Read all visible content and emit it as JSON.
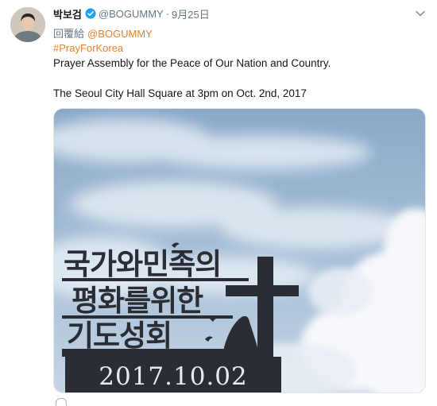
{
  "tweet": {
    "display_name": "박보검",
    "handle": "@BOGUMMY",
    "separator": "·",
    "date": "9月25日",
    "reply_prefix": "回覆給",
    "reply_handle": "@BOGUMMY",
    "hashtag": "#PrayForKorea",
    "body_line1": "Prayer Assembly for the Peace of Our Nation and Country.",
    "body_line2": "The Seoul City Hall Square at 3pm on Oct. 2nd, 2017"
  },
  "media": {
    "sign_line1": "국가와민족의",
    "sign_line2": "평화를위한",
    "sign_line3": "기도성회",
    "sign_date": "2017.10.02"
  },
  "icons": {
    "avatar": "avatar",
    "verified": "verified-badge-icon",
    "caret": "chevron-down-icon",
    "reply_action": "reply-icon"
  },
  "colors": {
    "link": "#e8822b",
    "verified": "#1da1f2",
    "muted": "#657786",
    "text": "#14171a",
    "sky": "#9cb8d4"
  }
}
